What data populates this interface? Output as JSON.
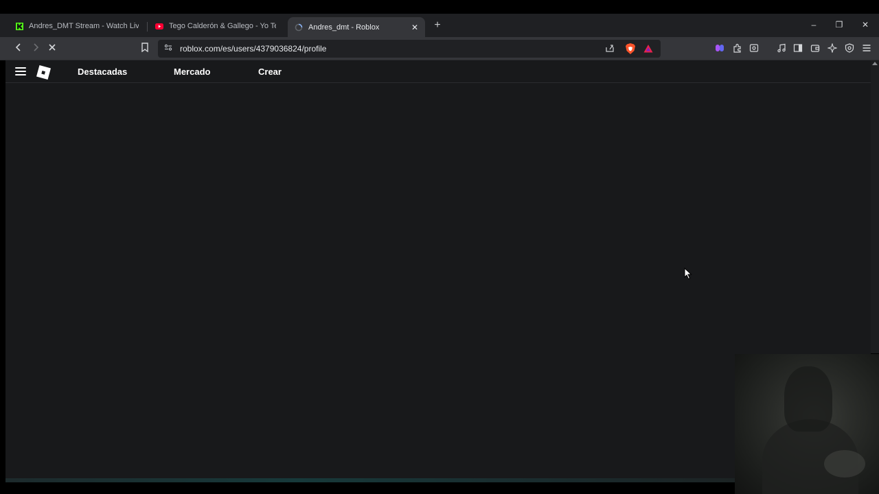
{
  "browser": {
    "tabs": [
      {
        "title": "Andres_DMT Stream - Watch Live on",
        "icon": "kick-icon",
        "active": false
      },
      {
        "title": "Tego Calderón & Gallego - Yo Tengo",
        "icon": "youtube-icon",
        "active": false
      },
      {
        "title": "Andres_dmt - Roblox",
        "icon": "roblox-loading-icon",
        "active": true
      }
    ],
    "close_tab_glyph": "✕",
    "new_tab_glyph": "+",
    "window_controls": {
      "minimize": "–",
      "maximize": "❐",
      "close": "✕"
    },
    "url": "roblox.com/es/users/4379036824/profile",
    "toolbar_icons": [
      "back-icon",
      "forward-icon",
      "stop-icon",
      "bookmark-icon",
      "share-icon",
      "brave-shields-icon",
      "brave-rewards-icon",
      "extensions-icon",
      "music-icon",
      "sidebar-icon",
      "wallet-icon",
      "leo-icon",
      "vpn-icon",
      "menu-icon"
    ]
  },
  "roblox": {
    "nav": {
      "featured": "Destacadas",
      "marketplace": "Mercado",
      "create": "Crear"
    }
  },
  "colors": {
    "page_bg": "#18191b",
    "tab_strip": "#1f2023",
    "toolbar": "#35363a",
    "kick_green": "#53fc18",
    "youtube_red": "#ff0033",
    "brave_orange": "#fb542b"
  }
}
